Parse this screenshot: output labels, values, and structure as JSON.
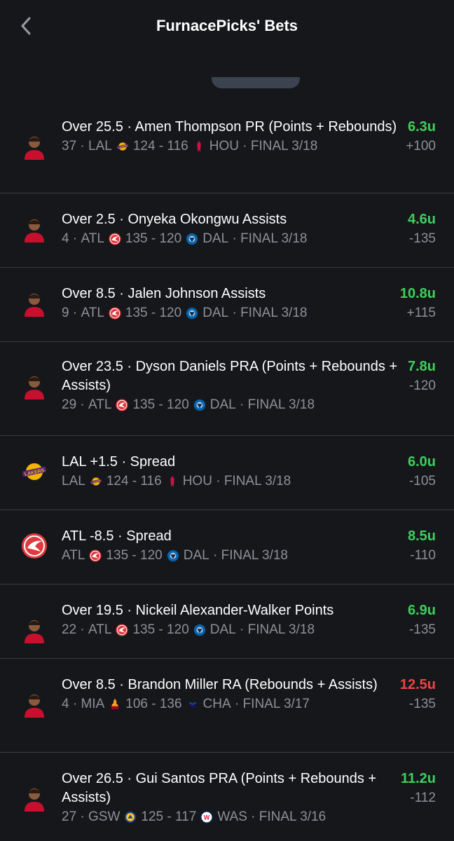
{
  "header": {
    "title": "FurnacePicks' Bets",
    "back_icon": "chevron-left-icon"
  },
  "colors": {
    "background": "#16171b",
    "win": "#3ecf5c",
    "loss": "#ee4444",
    "muted": "#8e9097",
    "divider": "#3a3b40"
  },
  "bets": [
    {
      "avatar": "player-avatar-icon",
      "title": "Over 25.5 · Amen Thompson PR (Points + Rebounds)",
      "stat": "37",
      "team1": "LAL",
      "team1_logo": "lakers-logo-icon",
      "score": "124 - 116",
      "team2": "HOU",
      "team2_logo": "rockets-logo-icon",
      "status": "FINAL 3/18",
      "units": "6.3u",
      "result": "win",
      "odds": "+100"
    },
    {
      "avatar": "player-avatar-icon",
      "title": "Over 2.5 · Onyeka Okongwu Assists",
      "stat": "4",
      "team1": "ATL",
      "team1_logo": "hawks-logo-icon",
      "score": "135 - 120",
      "team2": "DAL",
      "team2_logo": "mavericks-logo-icon",
      "status": "FINAL 3/18",
      "units": "4.6u",
      "result": "win",
      "odds": "-135"
    },
    {
      "avatar": "player-avatar-icon",
      "title": "Over 8.5 · Jalen Johnson Assists",
      "stat": "9",
      "team1": "ATL",
      "team1_logo": "hawks-logo-icon",
      "score": "135 - 120",
      "team2": "DAL",
      "team2_logo": "mavericks-logo-icon",
      "status": "FINAL 3/18",
      "units": "10.8u",
      "result": "win",
      "odds": "+115"
    },
    {
      "avatar": "player-avatar-icon",
      "title": "Over 23.5 · Dyson Daniels PRA (Points + Rebounds + Assists)",
      "stat": "29",
      "team1": "ATL",
      "team1_logo": "hawks-logo-icon",
      "score": "135 - 120",
      "team2": "DAL",
      "team2_logo": "mavericks-logo-icon",
      "status": "FINAL 3/18",
      "units": "7.8u",
      "result": "win",
      "odds": "-120"
    },
    {
      "avatar": "lakers-logo-icon",
      "title": "LAL +1.5 · Spread",
      "stat": "",
      "team1": "LAL",
      "team1_logo": "lakers-logo-icon",
      "score": "124 - 116",
      "team2": "HOU",
      "team2_logo": "rockets-logo-icon",
      "status": "FINAL 3/18",
      "units": "6.0u",
      "result": "win",
      "odds": "-105"
    },
    {
      "avatar": "hawks-logo-icon",
      "title": "ATL -8.5 · Spread",
      "stat": "",
      "team1": "ATL",
      "team1_logo": "hawks-logo-icon",
      "score": "135 - 120",
      "team2": "DAL",
      "team2_logo": "mavericks-logo-icon",
      "status": "FINAL 3/18",
      "units": "8.5u",
      "result": "win",
      "odds": "-110"
    },
    {
      "avatar": "player-avatar-icon",
      "title": "Over 19.5 · Nickeil Alexander-Walker Points",
      "stat": "22",
      "team1": "ATL",
      "team1_logo": "hawks-logo-icon",
      "score": "135 - 120",
      "team2": "DAL",
      "team2_logo": "mavericks-logo-icon",
      "status": "FINAL 3/18",
      "units": "6.9u",
      "result": "win",
      "odds": "-135"
    },
    {
      "avatar": "player-avatar-icon",
      "title": "Over 8.5 · Brandon Miller RA (Rebounds + Assists)",
      "stat": "4",
      "team1": "MIA",
      "team1_logo": "heat-logo-icon",
      "score": "106 - 136",
      "team2": "CHA",
      "team2_logo": "hornets-logo-icon",
      "status": "FINAL 3/17",
      "units": "12.5u",
      "result": "loss",
      "odds": "-135"
    },
    {
      "avatar": "player-avatar-icon",
      "title": "Over 26.5 · Gui Santos PRA (Points + Rebounds + Assists)",
      "stat": "27",
      "team1": "GSW",
      "team1_logo": "warriors-logo-icon",
      "score": "125 - 117",
      "team2": "WAS",
      "team2_logo": "wizards-logo-icon",
      "status": "FINAL 3/16",
      "units": "11.2u",
      "result": "win",
      "odds": "-112"
    }
  ]
}
